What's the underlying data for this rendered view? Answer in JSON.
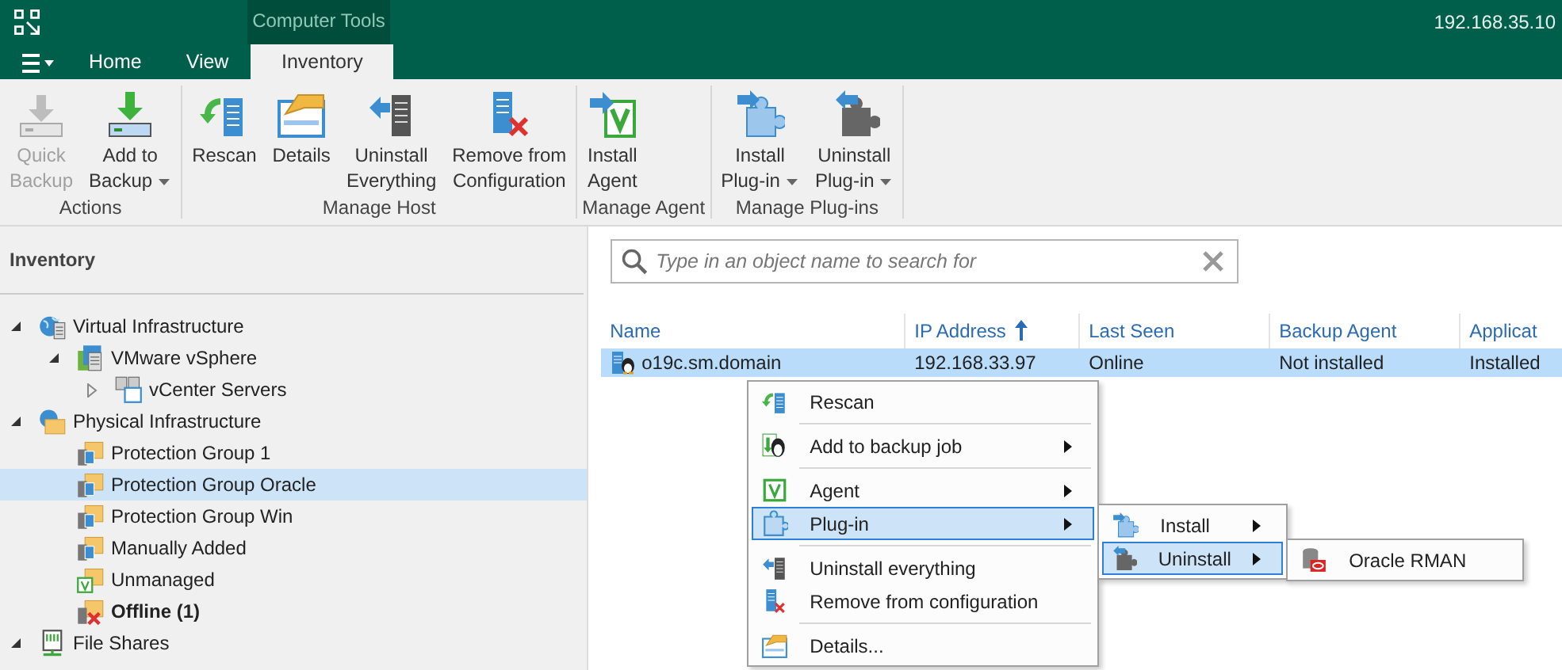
{
  "title_bar": {
    "context_tab_group": "Computer Tools",
    "server": "192.168.35.10"
  },
  "ribbon_tabs": [
    {
      "label": "Home",
      "selected": false
    },
    {
      "label": "View",
      "selected": false
    },
    {
      "label": "Inventory",
      "selected": true
    }
  ],
  "ribbon_groups": [
    {
      "label": "Actions",
      "buttons": [
        {
          "lines": [
            "Quick",
            "Backup"
          ],
          "disabled": true,
          "dropdown": false
        },
        {
          "lines": [
            "Add to",
            "Backup"
          ],
          "disabled": false,
          "dropdown": true
        }
      ]
    },
    {
      "label": "Manage Host",
      "buttons": [
        {
          "lines": [
            "Rescan"
          ],
          "disabled": false,
          "dropdown": false
        },
        {
          "lines": [
            "Details"
          ],
          "disabled": false,
          "dropdown": false
        },
        {
          "lines": [
            "Uninstall",
            "Everything"
          ],
          "disabled": false,
          "dropdown": false
        },
        {
          "lines": [
            "Remove from",
            "Configuration"
          ],
          "disabled": false,
          "dropdown": false
        }
      ]
    },
    {
      "label": "Manage Agent",
      "buttons": [
        {
          "lines": [
            "Install",
            "Agent"
          ],
          "disabled": false,
          "dropdown": false
        }
      ]
    },
    {
      "label": "Manage Plug-ins",
      "buttons": [
        {
          "lines": [
            "Install",
            "Plug-in"
          ],
          "disabled": false,
          "dropdown": true
        },
        {
          "lines": [
            "Uninstall",
            "Plug-in"
          ],
          "disabled": false,
          "dropdown": true
        }
      ]
    }
  ],
  "inventory_panel": {
    "title": "Inventory",
    "tree": [
      {
        "label": "Virtual Infrastructure",
        "expanded": true,
        "selected": false,
        "bold": false,
        "children": [
          {
            "label": "VMware vSphere",
            "expanded": true,
            "selected": false,
            "bold": false,
            "children": [
              {
                "label": "vCenter Servers",
                "expanded": false,
                "selected": false,
                "bold": false
              }
            ]
          }
        ]
      },
      {
        "label": "Physical Infrastructure",
        "expanded": true,
        "selected": false,
        "bold": false,
        "children": [
          {
            "label": "Protection Group 1",
            "selected": false,
            "bold": false
          },
          {
            "label": "Protection Group Oracle",
            "selected": true,
            "bold": false
          },
          {
            "label": "Protection Group Win",
            "selected": false,
            "bold": false
          },
          {
            "label": "Manually Added",
            "selected": false,
            "bold": false
          },
          {
            "label": "Unmanaged",
            "selected": false,
            "bold": false
          },
          {
            "label": "Offline (1)",
            "selected": false,
            "bold": true
          }
        ]
      },
      {
        "label": "File Shares",
        "expanded": true,
        "selected": false,
        "bold": false
      }
    ]
  },
  "search": {
    "placeholder": "Type in an object name to search for"
  },
  "table": {
    "columns": [
      {
        "label": "Name",
        "sorted": false
      },
      {
        "label": "IP Address",
        "sorted": true
      },
      {
        "label": "Last Seen",
        "sorted": false
      },
      {
        "label": "Backup Agent",
        "sorted": false
      },
      {
        "label": "Applicat",
        "sorted": false
      }
    ],
    "rows": [
      {
        "selected": true,
        "cells": [
          "o19c.sm.domain",
          "192.168.33.97",
          "Online",
          "Not installed",
          "Installed"
        ]
      }
    ]
  },
  "context_menu": [
    {
      "kind": "item",
      "label": "Rescan",
      "has_submenu": false,
      "selected": false
    },
    {
      "kind": "separator"
    },
    {
      "kind": "item",
      "label": "Add to backup job",
      "has_submenu": true,
      "selected": false
    },
    {
      "kind": "separator"
    },
    {
      "kind": "item",
      "label": "Agent",
      "has_submenu": true,
      "selected": false
    },
    {
      "kind": "item",
      "label": "Plug-in",
      "has_submenu": true,
      "selected": true,
      "submenu": [
        {
          "kind": "item",
          "label": "Install",
          "has_submenu": true,
          "selected": false
        },
        {
          "kind": "item",
          "label": "Uninstall",
          "has_submenu": true,
          "selected": true,
          "submenu": [
            {
              "kind": "item",
              "label": "Oracle RMAN",
              "has_submenu": false,
              "selected": false
            }
          ]
        }
      ]
    },
    {
      "kind": "separator"
    },
    {
      "kind": "item",
      "label": "Uninstall everything",
      "has_submenu": false,
      "selected": false
    },
    {
      "kind": "item",
      "label": "Remove from configuration",
      "has_submenu": false,
      "selected": false
    },
    {
      "kind": "separator"
    },
    {
      "kind": "item",
      "label": "Details...",
      "has_submenu": false,
      "selected": false
    }
  ]
}
